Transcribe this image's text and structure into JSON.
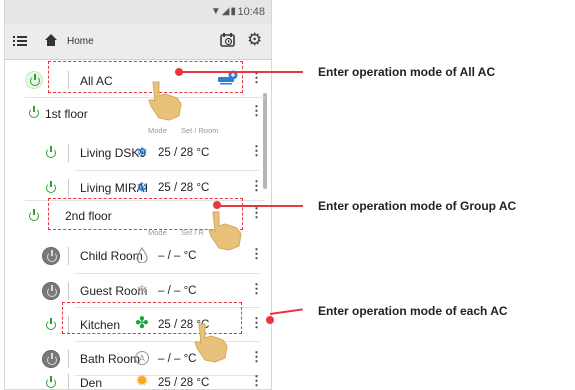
{
  "status_bar": {
    "time": "10:48",
    "icons": "▼◢▮"
  },
  "app_bar": {
    "title": "Home",
    "menu_icon": "list-menu-icon",
    "home_icon": "home-icon",
    "schedule_icon": "schedule-timer-icon",
    "settings_icon": "gear-icon",
    "settings_glyph": "⚙"
  },
  "list": {
    "header": {
      "mode": "Mode",
      "set_room": "Set / Room"
    },
    "header2": {
      "mode": "Mode",
      "set_room": "Set / R"
    },
    "all_ac": {
      "label": "All AC",
      "power": "on"
    },
    "groups": [
      {
        "label": "1st floor",
        "power": "on",
        "units": [
          {
            "name": "Living DSK9",
            "power": "on",
            "mode": "cool",
            "temp": "25 / 28 °C"
          },
          {
            "name": "Living MIRAI",
            "power": "on",
            "mode": "cool",
            "temp": "25 / 28 °C"
          }
        ]
      },
      {
        "label": "2nd floor",
        "power": "on",
        "units": [
          {
            "name": "Child Room",
            "power": "off",
            "mode": "dry",
            "temp": "– / –   °C"
          },
          {
            "name": "Guest Room",
            "power": "off",
            "mode": "cool",
            "temp": "– / –   °C"
          },
          {
            "name": "Kitchen",
            "power": "on",
            "mode": "fan",
            "temp": "25 / 28 °C"
          },
          {
            "name": "Bath Room",
            "power": "off",
            "mode": "auto",
            "temp": "– / –   °C"
          },
          {
            "name": "Den",
            "power": "on",
            "mode": "heat",
            "temp": "25 / 28 °C"
          }
        ]
      }
    ],
    "more_glyph": "⋮"
  },
  "callouts": [
    {
      "text": "Enter operation mode of All AC"
    },
    {
      "text": "Enter operation mode of Group AC"
    },
    {
      "text": "Enter operation mode of each AC"
    }
  ],
  "colors": {
    "accent_red": "#e8383d",
    "power_on": "#29a329",
    "cool": "#2b7fd9",
    "fan": "#1aa33a",
    "heat": "#f5a623",
    "hand": "#e8c27a"
  }
}
